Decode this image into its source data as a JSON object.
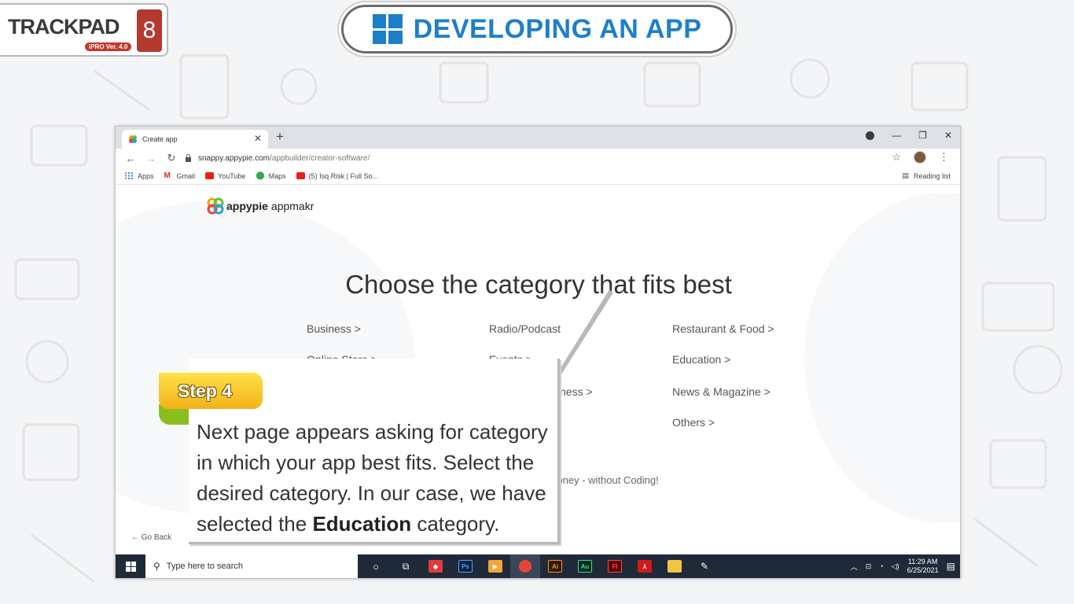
{
  "logo": {
    "brand": "TRACKPAD",
    "version": "iPRO Ver. 4.0",
    "grade": "8"
  },
  "title": "DEVELOPING AN APP",
  "browser": {
    "tab_title": "Create app",
    "url_domain": "snappy.appypie.com",
    "url_path": "/appbuilder/creator-software/",
    "bookmarks": [
      "Apps",
      "Gmail",
      "YouTube",
      "Maps",
      "(5) Isq Risk | Full So..."
    ],
    "reading_list": "Reading list"
  },
  "page": {
    "brand_bold": "appypie",
    "brand_sub": "appmakr",
    "heading": "Choose the category that fits best",
    "categories": [
      "Business >",
      "Radio/Podcast",
      "Restaurant & Food >",
      "Online Store >",
      "Events >",
      "Education >",
      "ness >",
      "News & Magazine >",
      "Others >"
    ],
    "tagline": "p and start making money - without Coding!",
    "go_back": "← Go Back"
  },
  "taskbar": {
    "search_placeholder": "Type here to search",
    "time": "11:29 AM",
    "date": "6/25/2021"
  },
  "callout": {
    "step": "Step 4",
    "text_before": "Next page appears asking for category in which your app best fits. Select the desired category. In our case, we have selected the ",
    "text_bold": "Education",
    "text_after": " category."
  },
  "colors": {
    "title_blue": "#1e7fc9",
    "step_yellow": "#f3b318",
    "step_green": "#8cbd1e",
    "taskbar": "#1f2a38"
  }
}
